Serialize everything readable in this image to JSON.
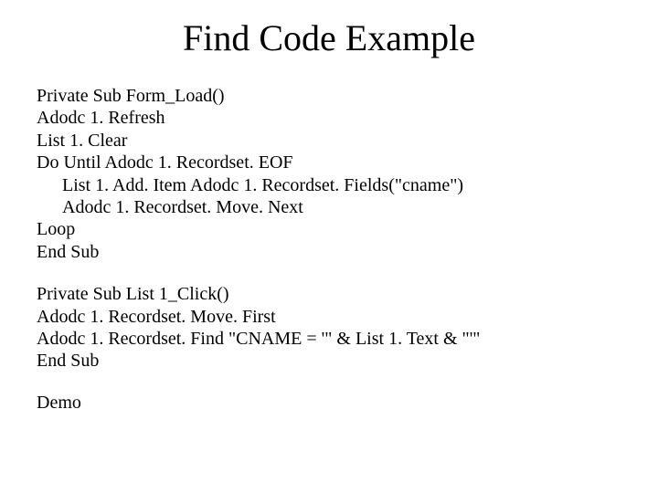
{
  "title": "Find Code Example",
  "block1": {
    "l1": "Private Sub Form_Load()",
    "l2": "Adodc 1. Refresh",
    "l3": "List 1. Clear",
    "l4": "Do Until Adodc 1. Recordset. EOF",
    "l5": "List 1. Add. Item Adodc 1. Recordset. Fields(\"cname\")",
    "l6": "Adodc 1. Recordset. Move. Next",
    "l7": "Loop",
    "l8": "End Sub"
  },
  "block2": {
    "l1": "Private Sub List 1_Click()",
    "l2": "Adodc 1. Recordset. Move. First",
    "l3": "Adodc 1. Recordset. Find \"CNAME = '\" & List 1. Text & \"'\"",
    "l4": "End Sub"
  },
  "demo": "Demo"
}
